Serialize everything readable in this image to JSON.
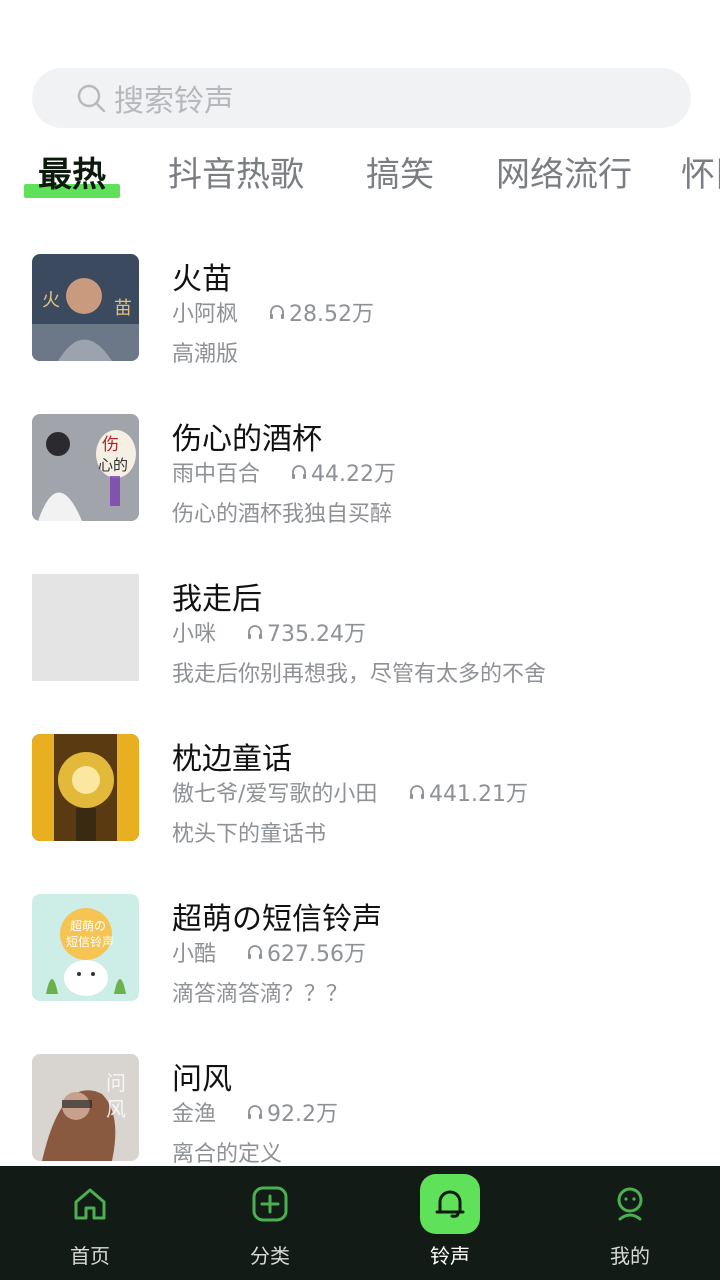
{
  "search": {
    "placeholder": "搜索铃声"
  },
  "tabs": [
    {
      "label": "最热",
      "active": true
    },
    {
      "label": "抖音热歌"
    },
    {
      "label": "搞笑"
    },
    {
      "label": "网络流行"
    },
    {
      "label": "怀旧"
    }
  ],
  "songs": [
    {
      "title": "火苗",
      "artist": "小阿枫",
      "plays": "28.52万",
      "desc": "高潮版"
    },
    {
      "title": "伤心的酒杯",
      "artist": "雨中百合",
      "plays": "44.22万",
      "desc": "伤心的酒杯我独自买醉"
    },
    {
      "title": "我走后",
      "artist": "小咪",
      "plays": "735.24万",
      "desc": "我走后你别再想我，尽管有太多的不舍"
    },
    {
      "title": "枕边童话",
      "artist": "傲七爷/爱写歌的小田",
      "plays": "441.21万",
      "desc": "枕头下的童话书"
    },
    {
      "title": "超萌の短信铃声",
      "artist": "小酷",
      "plays": "627.56万",
      "desc": "滴答滴答滴？？？"
    },
    {
      "title": "问风",
      "artist": "金渔",
      "plays": "92.2万",
      "desc": "离合的定义"
    }
  ],
  "nav": [
    {
      "label": "首页",
      "icon": "home-icon"
    },
    {
      "label": "分类",
      "icon": "plus-square-icon"
    },
    {
      "label": "铃声",
      "icon": "bell-icon",
      "active": true
    },
    {
      "label": "我的",
      "icon": "user-icon"
    }
  ],
  "colors": {
    "accent": "#5fe15a",
    "nav_bg": "#121b15"
  }
}
